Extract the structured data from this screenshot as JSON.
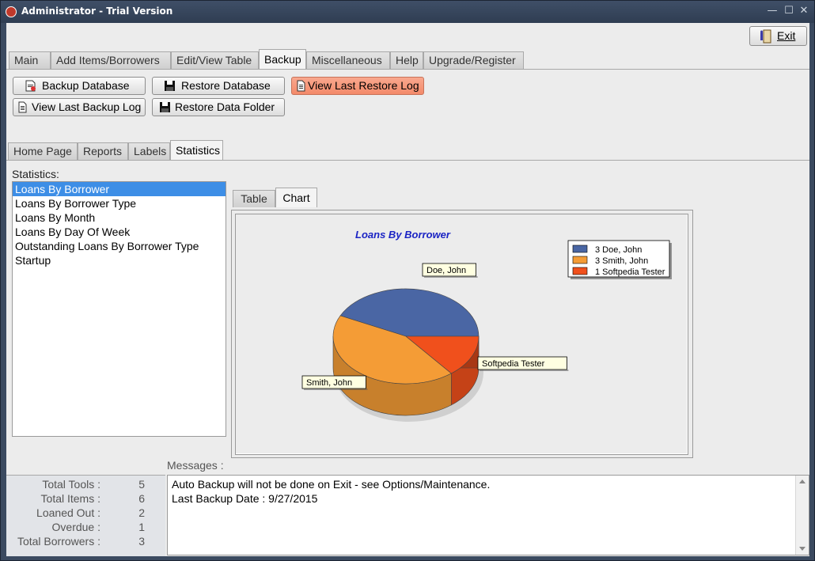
{
  "window": {
    "title": "Administrator - Trial Version",
    "controls": {
      "minimize": "—",
      "maximize": "☐",
      "close": "✕"
    }
  },
  "exit_button": {
    "label": "Exit",
    "icon": "door-exit-icon"
  },
  "main_tabs": [
    {
      "label": "Main",
      "active": false
    },
    {
      "label": "Add Items/Borrowers",
      "active": false
    },
    {
      "label": "Edit/View Table",
      "active": false
    },
    {
      "label": "Backup",
      "active": true
    },
    {
      "label": "Miscellaneous",
      "active": false
    },
    {
      "label": "Help",
      "active": false
    },
    {
      "label": "Upgrade/Register",
      "active": false
    }
  ],
  "backup_buttons": {
    "backup_database": {
      "label": "Backup Database",
      "icon": "database-backup-icon"
    },
    "restore_database": {
      "label": "Restore Database",
      "icon": "floppy-disk-icon"
    },
    "view_last_restore_log": {
      "label": "View Last Restore Log",
      "icon": "document-icon",
      "color": "#f38a6a"
    },
    "view_last_backup_log": {
      "label": "View Last Backup Log",
      "icon": "document-icon"
    },
    "restore_data_folder": {
      "label": "Restore Data Folder",
      "icon": "floppy-disk-icon"
    }
  },
  "sub_tabs": [
    {
      "label": "Home Page",
      "active": false
    },
    {
      "label": "Reports",
      "active": false
    },
    {
      "label": "Labels",
      "active": false
    },
    {
      "label": "Statistics",
      "active": true
    }
  ],
  "statistics": {
    "label": "Statistics:",
    "items": [
      {
        "label": "Loans By Borrower",
        "selected": true
      },
      {
        "label": "Loans By Borrower Type",
        "selected": false
      },
      {
        "label": "Loans By Month",
        "selected": false
      },
      {
        "label": "Loans By Day Of Week",
        "selected": false
      },
      {
        "label": "Outstanding Loans By Borrower Type",
        "selected": false
      },
      {
        "label": "Startup",
        "selected": false
      }
    ]
  },
  "chart_tabs": [
    {
      "label": "Table",
      "active": false
    },
    {
      "label": "Chart",
      "active": true
    }
  ],
  "chart_data": {
    "type": "pie",
    "title": "Loans By Borrower",
    "three_d": true,
    "legend_position": "top-right",
    "slices": [
      {
        "name": "Doe, John",
        "value": 3,
        "legend": "3 Doe, John",
        "color": "#4a66a4"
      },
      {
        "name": "Smith, John",
        "value": 3,
        "legend": "3 Smith, John",
        "color": "#f49c36"
      },
      {
        "name": "Softpedia Tester",
        "value": 1,
        "legend": "1 Softpedia Tester",
        "color": "#f0501c"
      }
    ]
  },
  "messages": {
    "label": "Messages :",
    "lines": [
      "Auto Backup will not be done on Exit - see Options/Maintenance.",
      "Last Backup Date : 9/27/2015"
    ]
  },
  "totals": [
    {
      "label": "Total Tools :",
      "value": "5"
    },
    {
      "label": "Total Items :",
      "value": "6"
    },
    {
      "label": "Loaned Out :",
      "value": "2"
    },
    {
      "label": "Overdue :",
      "value": "1"
    },
    {
      "label": "Total Borrowers :",
      "value": "3"
    }
  ]
}
